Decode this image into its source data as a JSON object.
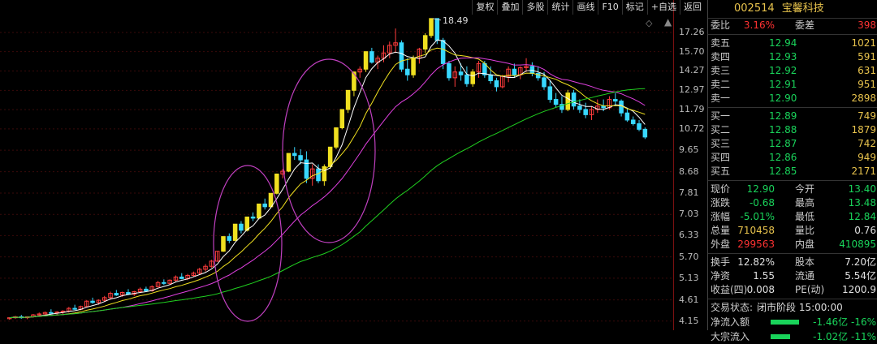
{
  "toolbar": [
    "复权",
    "叠加",
    "多股",
    "统计",
    "画线",
    "F10",
    "标记",
    "+自选",
    "返回"
  ],
  "stock": {
    "code": "002514",
    "name": "宝馨科技"
  },
  "header": {
    "weibi_label": "委比",
    "weibi_value": "3.16%",
    "weicha_label": "委差",
    "weicha_value": "398"
  },
  "sell_orders": [
    {
      "label": "卖五",
      "price": "12.94",
      "qty": "1021"
    },
    {
      "label": "卖四",
      "price": "12.93",
      "qty": "591"
    },
    {
      "label": "卖三",
      "price": "12.92",
      "qty": "631"
    },
    {
      "label": "卖二",
      "price": "12.91",
      "qty": "951"
    },
    {
      "label": "卖一",
      "price": "12.90",
      "qty": "2898"
    }
  ],
  "buy_orders": [
    {
      "label": "买一",
      "price": "12.89",
      "qty": "749"
    },
    {
      "label": "买二",
      "price": "12.88",
      "qty": "1879"
    },
    {
      "label": "买三",
      "price": "12.87",
      "qty": "742"
    },
    {
      "label": "买四",
      "price": "12.86",
      "qty": "949"
    },
    {
      "label": "买五",
      "price": "12.85",
      "qty": "2171"
    }
  ],
  "quote": [
    {
      "l1": "现价",
      "v1": "12.90",
      "c1": "green",
      "l2": "今开",
      "v2": "13.40",
      "c2": "green"
    },
    {
      "l1": "涨跌",
      "v1": "-0.68",
      "c1": "green",
      "l2": "最高",
      "v2": "13.48",
      "c2": "green"
    },
    {
      "l1": "涨幅",
      "v1": "-5.01%",
      "c1": "green",
      "l2": "最低",
      "v2": "12.84",
      "c2": "green"
    },
    {
      "l1": "总量",
      "v1": "710458",
      "c1": "yellow",
      "l2": "量比",
      "v2": "0.76",
      "c2": "white"
    },
    {
      "l1": "外盘",
      "v1": "299563",
      "c1": "red",
      "l2": "内盘",
      "v2": "410895",
      "c2": "green"
    }
  ],
  "fundamentals": [
    {
      "l1": "换手",
      "v1": "12.82%",
      "l2": "股本",
      "v2": "7.20亿"
    },
    {
      "l1": "净资",
      "v1": "1.55",
      "l2": "流通",
      "v2": "5.54亿"
    },
    {
      "l1": "收益(四)",
      "v1": "0.008",
      "l2": "PE(动)",
      "v2": "1200.9"
    }
  ],
  "trade_status": {
    "label": "交易状态:",
    "value": "闭市阶段 15:00:00"
  },
  "flows": [
    {
      "label": "净流入额",
      "value": "-1.46亿 -16%",
      "pct": 0.16
    },
    {
      "label": "大宗流入",
      "value": "-1.02亿 -11%",
      "pct": 0.11
    }
  ],
  "chart_data": {
    "type": "candlestick",
    "max_label": "18.49",
    "y_ticks": [
      17.26,
      15.7,
      14.27,
      12.97,
      11.79,
      10.72,
      9.65,
      8.68,
      7.81,
      7.03,
      6.33,
      5.7,
      5.13,
      4.61,
      4.15
    ],
    "y_range": [
      4.0,
      18.7
    ],
    "candles": [
      [
        4.2,
        4.22,
        4.18,
        4.22
      ],
      [
        4.22,
        4.26,
        4.2,
        4.24
      ],
      [
        4.24,
        4.28,
        4.2,
        4.22
      ],
      [
        4.22,
        4.25,
        4.19,
        4.24
      ],
      [
        4.24,
        4.3,
        4.22,
        4.28
      ],
      [
        4.28,
        4.33,
        4.25,
        4.3
      ],
      [
        4.3,
        4.35,
        4.27,
        4.33
      ],
      [
        4.33,
        4.4,
        4.3,
        4.32
      ],
      [
        4.32,
        4.36,
        4.28,
        4.34
      ],
      [
        4.34,
        4.38,
        4.3,
        4.36
      ],
      [
        4.36,
        4.45,
        4.33,
        4.42
      ],
      [
        4.42,
        4.5,
        4.38,
        4.4
      ],
      [
        4.4,
        4.48,
        4.38,
        4.46
      ],
      [
        4.46,
        4.6,
        4.44,
        4.58
      ],
      [
        4.58,
        4.66,
        4.52,
        4.55
      ],
      [
        4.55,
        4.62,
        4.5,
        4.6
      ],
      [
        4.6,
        4.7,
        4.56,
        4.66
      ],
      [
        4.66,
        4.8,
        4.62,
        4.76
      ],
      [
        4.76,
        4.84,
        4.7,
        4.72
      ],
      [
        4.72,
        4.8,
        4.68,
        4.78
      ],
      [
        4.78,
        4.86,
        4.72,
        4.74
      ],
      [
        4.74,
        4.82,
        4.7,
        4.8
      ],
      [
        4.8,
        4.9,
        4.78,
        4.86
      ],
      [
        4.86,
        4.92,
        4.8,
        4.82
      ],
      [
        4.82,
        4.95,
        4.8,
        4.92
      ],
      [
        4.92,
        5.06,
        4.9,
        5.02
      ],
      [
        5.02,
        5.1,
        4.96,
        5.0
      ],
      [
        5.0,
        5.1,
        4.96,
        5.08
      ],
      [
        5.08,
        5.2,
        5.04,
        5.16
      ],
      [
        5.16,
        5.26,
        5.1,
        5.12
      ],
      [
        5.12,
        5.24,
        5.08,
        5.2
      ],
      [
        5.2,
        5.3,
        5.16,
        5.26
      ],
      [
        5.26,
        5.4,
        5.22,
        5.36
      ],
      [
        5.36,
        5.5,
        5.3,
        5.44
      ],
      [
        5.44,
        5.62,
        5.4,
        5.58
      ],
      [
        5.58,
        5.86,
        5.56,
        5.86
      ],
      [
        5.86,
        6.3,
        5.84,
        6.3
      ],
      [
        6.3,
        6.4,
        6.1,
        6.18
      ],
      [
        6.18,
        6.7,
        6.16,
        6.7
      ],
      [
        6.7,
        6.8,
        6.4,
        6.5
      ],
      [
        6.5,
        6.94,
        6.46,
        6.94
      ],
      [
        6.94,
        7.1,
        6.8,
        6.9
      ],
      [
        6.9,
        7.4,
        6.86,
        7.4
      ],
      [
        7.4,
        7.6,
        7.2,
        7.3
      ],
      [
        7.3,
        7.8,
        7.24,
        7.8
      ],
      [
        7.8,
        8.6,
        7.76,
        8.58
      ],
      [
        8.58,
        8.8,
        8.4,
        8.7
      ],
      [
        8.7,
        9.5,
        8.66,
        9.5
      ],
      [
        9.5,
        9.8,
        9.2,
        9.4
      ],
      [
        9.4,
        9.7,
        9.0,
        9.2
      ],
      [
        9.2,
        9.6,
        8.2,
        8.4
      ],
      [
        8.4,
        9.0,
        8.1,
        8.8
      ],
      [
        8.8,
        9.0,
        8.2,
        8.3
      ],
      [
        8.3,
        9.0,
        8.1,
        8.9
      ],
      [
        8.9,
        9.8,
        8.8,
        9.8
      ],
      [
        9.8,
        10.8,
        9.7,
        10.78
      ],
      [
        10.78,
        11.8,
        10.7,
        11.8
      ],
      [
        11.8,
        12.97,
        11.6,
        12.97
      ],
      [
        12.97,
        14.2,
        12.6,
        14.2
      ],
      [
        14.2,
        14.6,
        13.8,
        14.4
      ],
      [
        14.4,
        15.7,
        14.2,
        15.7
      ],
      [
        15.7,
        16.0,
        14.8,
        14.9
      ],
      [
        14.9,
        15.4,
        14.4,
        15.2
      ],
      [
        15.2,
        16.2,
        14.9,
        15.6
      ],
      [
        15.6,
        16.5,
        15.2,
        16.2
      ],
      [
        16.2,
        17.6,
        15.6,
        16.4
      ],
      [
        16.4,
        16.6,
        14.2,
        14.4
      ],
      [
        14.4,
        15.2,
        13.6,
        14.0
      ],
      [
        14.0,
        15.4,
        13.8,
        15.2
      ],
      [
        15.2,
        16.0,
        14.8,
        15.9
      ],
      [
        15.9,
        17.2,
        15.6,
        17.0
      ],
      [
        17.0,
        18.49,
        16.8,
        18.49
      ],
      [
        18.49,
        18.49,
        16.3,
        16.6
      ],
      [
        16.6,
        16.8,
        14.4,
        14.8
      ],
      [
        14.8,
        15.0,
        13.6,
        13.8
      ],
      [
        13.8,
        14.6,
        13.2,
        14.2
      ],
      [
        14.2,
        14.8,
        13.6,
        14.0
      ],
      [
        14.0,
        14.6,
        13.2,
        13.4
      ],
      [
        13.4,
        14.4,
        13.2,
        14.2
      ],
      [
        14.2,
        15.0,
        13.8,
        14.8
      ],
      [
        14.8,
        15.0,
        13.8,
        14.0
      ],
      [
        14.0,
        14.6,
        13.4,
        13.6
      ],
      [
        13.6,
        13.8,
        12.9,
        13.2
      ],
      [
        13.2,
        14.0,
        13.1,
        13.9
      ],
      [
        13.9,
        14.6,
        13.5,
        14.4
      ],
      [
        14.4,
        14.8,
        13.8,
        14.0
      ],
      [
        14.0,
        14.6,
        13.7,
        14.5
      ],
      [
        14.5,
        15.2,
        14.2,
        14.6
      ],
      [
        14.6,
        14.9,
        13.9,
        14.1
      ],
      [
        14.1,
        14.6,
        13.6,
        13.8
      ],
      [
        13.8,
        14.2,
        13.0,
        13.2
      ],
      [
        13.2,
        13.6,
        12.2,
        12.4
      ],
      [
        12.4,
        12.8,
        11.9,
        12.1
      ],
      [
        12.1,
        12.6,
        11.6,
        11.8
      ],
      [
        11.8,
        13.0,
        11.7,
        12.8
      ],
      [
        12.8,
        13.0,
        11.8,
        12.0
      ],
      [
        12.0,
        12.4,
        11.6,
        11.8
      ],
      [
        11.8,
        12.2,
        11.3,
        11.5
      ],
      [
        11.5,
        12.0,
        11.2,
        11.8
      ],
      [
        11.8,
        12.4,
        11.6,
        12.0
      ],
      [
        12.0,
        12.4,
        11.7,
        11.9
      ],
      [
        11.9,
        12.6,
        11.8,
        12.4
      ],
      [
        12.4,
        12.8,
        12.0,
        12.3
      ],
      [
        12.3,
        12.4,
        11.4,
        11.6
      ],
      [
        11.6,
        11.9,
        11.1,
        11.2
      ],
      [
        11.2,
        11.4,
        10.9,
        11.0
      ],
      [
        11.0,
        11.2,
        10.6,
        10.7
      ],
      [
        10.7,
        10.8,
        10.2,
        10.3
      ]
    ]
  }
}
